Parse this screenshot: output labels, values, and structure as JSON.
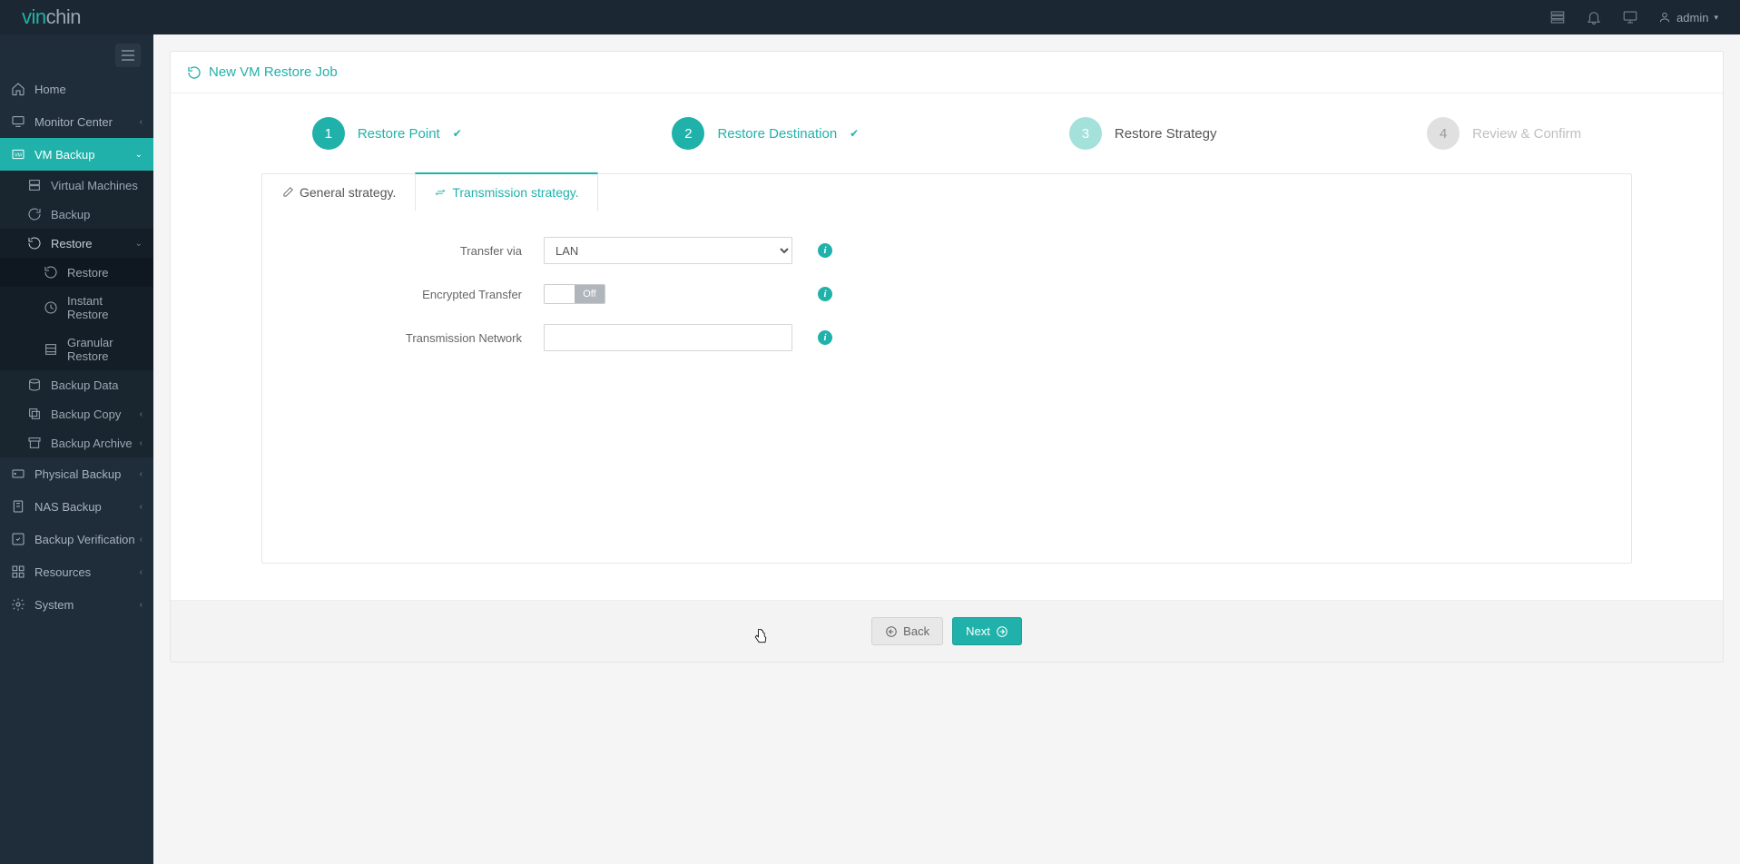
{
  "brand": {
    "pre": "vin",
    "post": "chin"
  },
  "user": {
    "name": "admin"
  },
  "header": {
    "title": "New VM Restore Job"
  },
  "sidebar": {
    "home": "Home",
    "monitor": "Monitor Center",
    "vm_backup": "VM Backup",
    "sub": {
      "vms": "Virtual Machines",
      "backup": "Backup",
      "restore": "Restore",
      "restore_sub": {
        "restore": "Restore",
        "instant": "Instant Restore",
        "granular": "Granular Restore"
      },
      "backup_data": "Backup Data",
      "backup_copy": "Backup Copy",
      "backup_archive": "Backup Archive"
    },
    "physical": "Physical Backup",
    "nas": "NAS Backup",
    "verification": "Backup Verification",
    "resources": "Resources",
    "system": "System"
  },
  "wizard": {
    "s1": {
      "num": "1",
      "label": "Restore Point"
    },
    "s2": {
      "num": "2",
      "label": "Restore Destination"
    },
    "s3": {
      "num": "3",
      "label": "Restore Strategy"
    },
    "s4": {
      "num": "4",
      "label": "Review & Confirm"
    }
  },
  "tabs": {
    "general": "General strategy.",
    "transmission": "Transmission strategy."
  },
  "form": {
    "transfer_via": {
      "label": "Transfer via",
      "value": "LAN"
    },
    "encrypted": {
      "label": "Encrypted Transfer",
      "value": "Off"
    },
    "network": {
      "label": "Transmission Network",
      "value": ""
    }
  },
  "buttons": {
    "back": "Back",
    "next": "Next"
  }
}
